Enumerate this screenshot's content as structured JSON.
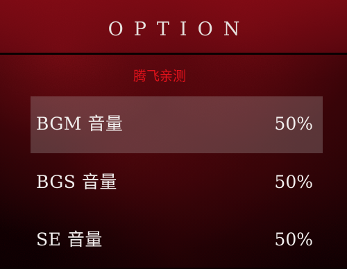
{
  "screen": {
    "title": "OPTION",
    "watermark": "腾飞亲测"
  },
  "options": [
    {
      "label": "BGM 音量",
      "value": "50%",
      "selected": true
    },
    {
      "label": "BGS 音量",
      "value": "50%",
      "selected": false
    },
    {
      "label": "SE 音量",
      "value": "50%",
      "selected": false
    }
  ],
  "colors": {
    "background_red": "#8c0c16",
    "title_text": "#e6e1de",
    "option_text": "#f2efee",
    "watermark_red": "#e0121b",
    "selection_highlight": "#afaaaa"
  }
}
